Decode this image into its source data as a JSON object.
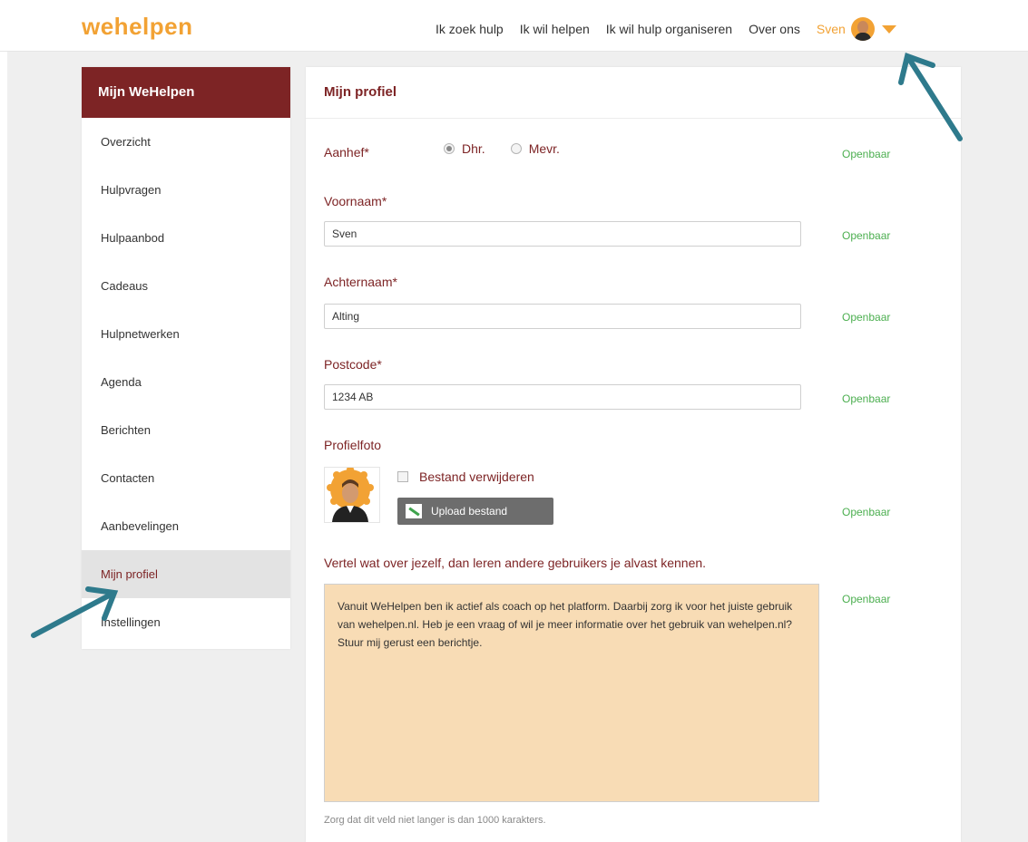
{
  "header": {
    "logo": "wehelpen",
    "nav": [
      "Ik zoek hulp",
      "Ik wil helpen",
      "Ik wil hulp organiseren",
      "Over ons"
    ],
    "user_name": "Sven"
  },
  "sidebar": {
    "title": "Mijn WeHelpen",
    "items": [
      {
        "label": "Overzicht"
      },
      {
        "label": "Hulpvragen"
      },
      {
        "label": "Hulpaanbod"
      },
      {
        "label": "Cadeaus"
      },
      {
        "label": "Hulpnetwerken"
      },
      {
        "label": "Agenda"
      },
      {
        "label": "Berichten"
      },
      {
        "label": "Contacten"
      },
      {
        "label": "Aanbevelingen"
      },
      {
        "label": "Mijn profiel",
        "active": true
      },
      {
        "label": "Instellingen"
      }
    ]
  },
  "main": {
    "title": "Mijn profiel",
    "public_label": "Openbaar",
    "salutation": {
      "label": "Aanhef*",
      "options": [
        "Dhr.",
        "Mevr."
      ],
      "selected": "Dhr."
    },
    "first_name": {
      "label": "Voornaam*",
      "value": "Sven"
    },
    "last_name": {
      "label": "Achternaam*",
      "value": "Alting"
    },
    "postcode": {
      "label": "Postcode*",
      "value": "1234 AB"
    },
    "photo": {
      "label": "Profielfoto",
      "delete_label": "Bestand verwijderen",
      "upload_label": "Upload bestand"
    },
    "about": {
      "label": "Vertel wat over jezelf, dan leren andere gebruikers je alvast kennen.",
      "value": "Vanuit WeHelpen ben ik actief als coach op het platform. Daarbij zorg ik voor het juiste gebruik van wehelpen.nl. Heb je een vraag of wil je meer informatie over het gebruik van wehelpen.nl? Stuur mij gerust een berichtje.",
      "hint": "Zorg dat dit veld niet langer is dan 1000 karakters."
    }
  },
  "colors": {
    "brand_orange": "#f2a234",
    "brand_red": "#7d2425",
    "public_green": "#4caf50",
    "textarea_bg": "#f8dcb5",
    "arrow": "#2e7a8c"
  }
}
